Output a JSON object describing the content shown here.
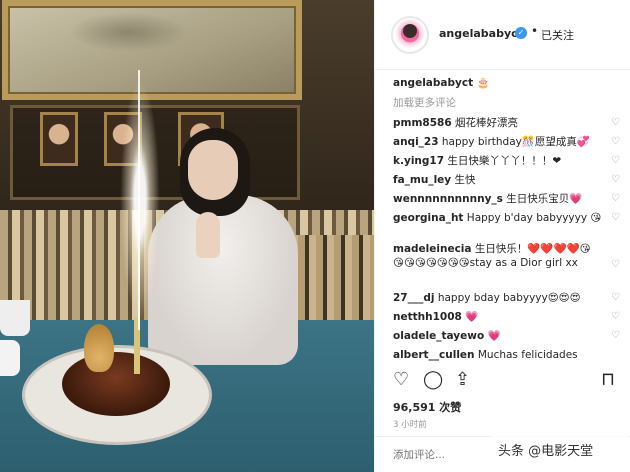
{
  "post": {
    "username": "angelababyct",
    "follow_status": "已关注",
    "dot": "•",
    "caption_emoji": "🎂",
    "load_more": "加载更多评论",
    "likes": "96,591 次赞",
    "time": "3 小时前",
    "add_comment_placeholder": "添加评论...",
    "colors": {
      "verified": "#3897f0",
      "muted": "#999999",
      "text": "#262626"
    }
  },
  "comments": [
    {
      "user": "pmm8586",
      "text": "烟花棒好漂亮"
    },
    {
      "user": "anqi_23",
      "text": "happy birthday🎊愿望成真💞"
    },
    {
      "user": "k.ying17",
      "text": "生日快樂丫丫丫！！！❤"
    },
    {
      "user": "fa_mu_ley",
      "text": "生快"
    },
    {
      "user": "wennnnnnnnnny_s",
      "text": "生日快乐宝贝💗"
    },
    {
      "user": "georgina_ht",
      "text": "Happy b'day babyyyyy 😘"
    },
    {
      "user": "madeleinecia",
      "text": "生日快乐！❤️❤️❤️❤️😘"
    },
    {
      "user": "",
      "text": "😘😘😘😘😘😘😘stay as a Dior girl xx"
    },
    {
      "user": "27___dj",
      "text": "happy bday babyyyy😍😍😍"
    },
    {
      "user": "netthh1008",
      "text": "💗"
    },
    {
      "user": "oladele_tayewo",
      "text": "💗"
    },
    {
      "user": "albert__cullen",
      "text": "Muchas felicidades"
    }
  ],
  "actions": {
    "like_icon": "heart-outline-icon",
    "comment_icon": "comment-bubble-icon",
    "share_icon": "share-icon",
    "save_icon": "bookmark-icon"
  },
  "watermark": "头条 @电影天堂"
}
